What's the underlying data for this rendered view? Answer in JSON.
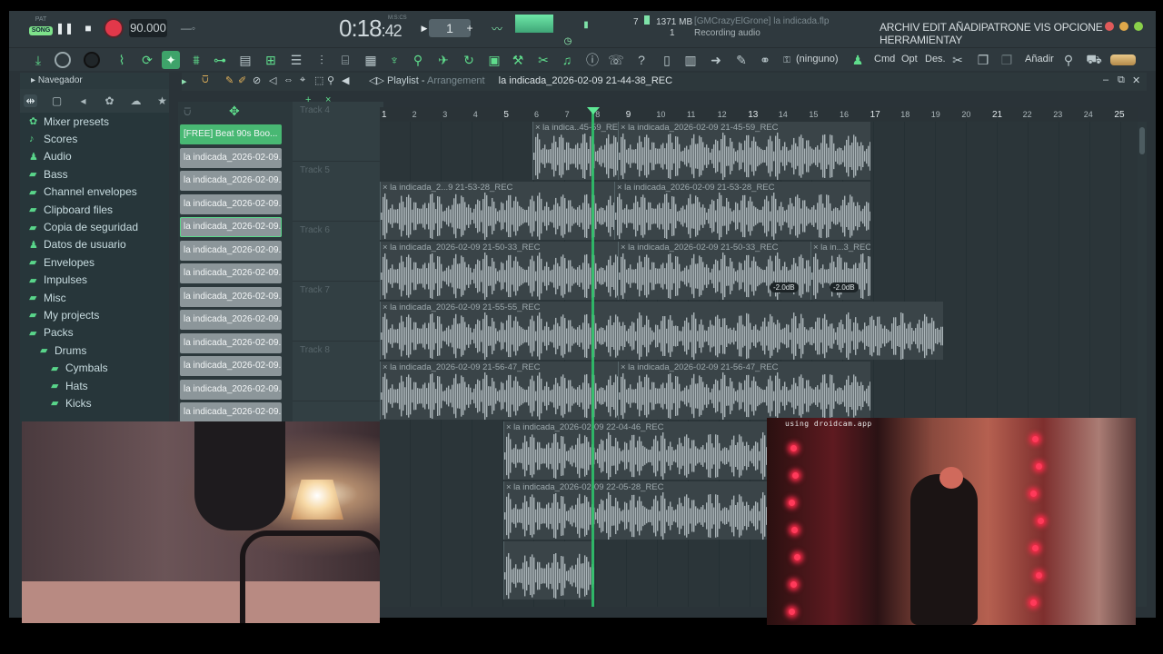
{
  "transport": {
    "pat_label": "PAT",
    "song_label": "SONG",
    "tempo": "90.000",
    "time": "0:18",
    "time_frac": ":42",
    "time_unit": "M:S:CS",
    "pattern": "1",
    "cpu_value": "7",
    "ram": "1371 MB",
    "poly": "1"
  },
  "hint": {
    "file": "[GMCrazyElGrone] la indicada.flp",
    "status": "Recording audio"
  },
  "menu": {
    "text": "ARCHIV EDIT AÑADIPATRONE VIS OPCIONE HERRAMIENTAY"
  },
  "toolbar": {
    "preset": "(ninguno)",
    "cmd": "Cmd",
    "opt": "Opt",
    "des": "Des.",
    "add": "Añadir"
  },
  "browser": {
    "title": "Navegador",
    "items": [
      {
        "label": "Mixer presets",
        "level": 0,
        "icon": "plugin-icon"
      },
      {
        "label": "Scores",
        "level": 0,
        "icon": "note-icon"
      },
      {
        "label": "Audio",
        "level": 0,
        "icon": "user-icon"
      },
      {
        "label": "Bass",
        "level": 0,
        "icon": "folder-icon"
      },
      {
        "label": "Channel envelopes",
        "level": 0,
        "icon": "folder-icon"
      },
      {
        "label": "Clipboard files",
        "level": 0,
        "icon": "folder-icon"
      },
      {
        "label": "Copia de seguridad",
        "level": 0,
        "icon": "folder-icon"
      },
      {
        "label": "Datos de usuario",
        "level": 0,
        "icon": "user-icon"
      },
      {
        "label": "Envelopes",
        "level": 0,
        "icon": "folder-icon"
      },
      {
        "label": "Impulses",
        "level": 0,
        "icon": "folder-icon"
      },
      {
        "label": "Misc",
        "level": 0,
        "icon": "folder-icon"
      },
      {
        "label": "My projects",
        "level": 0,
        "icon": "folder-icon"
      },
      {
        "label": "Packs",
        "level": 0,
        "icon": "folder-open-icon"
      },
      {
        "label": "Drums",
        "level": 1,
        "icon": "folder-open-icon"
      },
      {
        "label": "Cymbals",
        "level": 2,
        "icon": "folder-icon"
      },
      {
        "label": "Hats",
        "level": 2,
        "icon": "folder-icon"
      },
      {
        "label": "Kicks",
        "level": 2,
        "icon": "folder-icon"
      }
    ]
  },
  "playlist": {
    "title": "Playlist",
    "subtitle": "Arrangement",
    "file": "la indicada_2026-02-09 21-44-38_REC",
    "ruler": [
      "1",
      "2",
      "3",
      "4",
      "5",
      "6",
      "7",
      "8",
      "9",
      "10",
      "11",
      "12",
      "13",
      "14",
      "15",
      "16",
      "17",
      "18",
      "19",
      "20",
      "21",
      "22",
      "23",
      "24",
      "25"
    ]
  },
  "clip_list": [
    "[FREE] Beat 90s Boo...",
    "la indicada_2026-02-09...",
    "la indicada_2026-02-09...",
    "la indicada_2026-02-09...",
    "la indicada_2026-02-09...",
    "la indicada_2026-02-09...",
    "la indicada_2026-02-09...",
    "la indicada_2026-02-09...",
    "la indicada_2026-02-09...",
    "la indicada_2026-02-09...",
    "la indicada_2026-02-09...",
    "la indicada_2026-02-09...",
    "la indicada_2026-02-09..."
  ],
  "tracks": [
    "Track 4",
    "Track 5",
    "Track 6",
    "Track 7",
    "Track 8"
  ],
  "clips": [
    {
      "lane": 0,
      "start": 168,
      "len": 94,
      "label": "× la indica..45-59_REC"
    },
    {
      "lane": 0,
      "start": 262,
      "len": 278,
      "label": "× la indicada_2026-02-09 21-45-59_REC"
    },
    {
      "lane": 1,
      "start": 0,
      "len": 258,
      "label": "× la indicada_2...9 21-53-28_REC"
    },
    {
      "lane": 1,
      "start": 258,
      "len": 282,
      "label": "× la indicada_2026-02-09 21-53-28_REC"
    },
    {
      "lane": 2,
      "start": 0,
      "len": 262,
      "label": "× la indicada_2026-02-09 21-50-33_REC",
      "gain": ""
    },
    {
      "lane": 2,
      "start": 262,
      "len": 212,
      "label": "× la indicada_2026-02-09 21-50-33_REC",
      "gain": "-2.0dB"
    },
    {
      "lane": 2,
      "start": 474,
      "len": 66,
      "label": "× la in...3_REC",
      "gain": "-2.0dB"
    },
    {
      "lane": 3,
      "start": 0,
      "len": 620,
      "label": "× la indicada_2026-02-09 21-55-55_REC"
    },
    {
      "lane": 4,
      "start": 0,
      "len": 262,
      "label": "× la indicada_2026-02-09 21-56-47_REC"
    },
    {
      "lane": 4,
      "start": 262,
      "len": 278,
      "label": "× la indicada_2026-02-09 21-56-47_REC"
    },
    {
      "lane": 5,
      "start": 136,
      "len": 300,
      "label": "× la indicada_2026-02-09 22-04-46_REC"
    },
    {
      "lane": 6,
      "start": 136,
      "len": 300,
      "label": "× la indicada_2026-02-09 22-05-28_REC"
    },
    {
      "lane": 7,
      "start": 136,
      "len": 100,
      "label": ""
    }
  ],
  "webcam": {
    "watermark": "using droidcam.app"
  },
  "colors": {
    "accent": "#5fdc8c",
    "record": "#e2384a",
    "playhead": "#2fc26a"
  }
}
